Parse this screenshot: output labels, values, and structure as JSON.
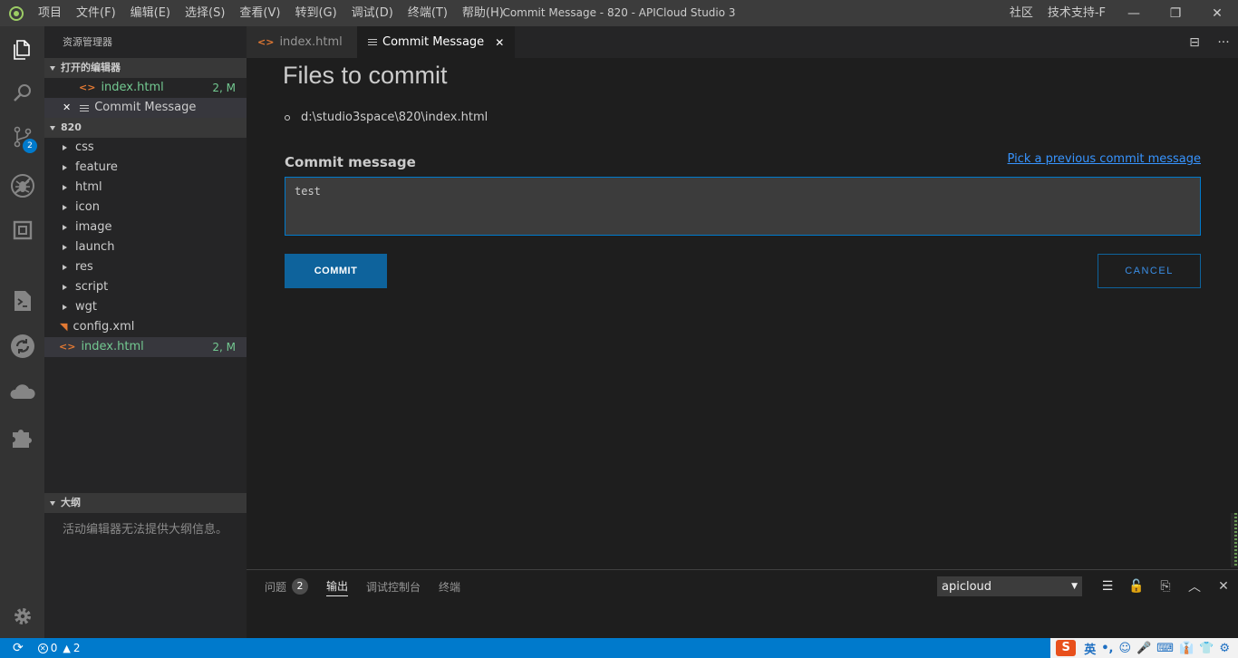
{
  "titlebar": {
    "menu": [
      "项目",
      "文件(F)",
      "编辑(E)",
      "选择(S)",
      "查看(V)",
      "转到(G)",
      "调试(D)",
      "终端(T)",
      "帮助(H)"
    ],
    "window_title": "Commit Message - 820 - APICloud Studio 3",
    "links": [
      "社区",
      "技术支持-F"
    ],
    "minimize": "—",
    "maximize": "❐",
    "close": "✕"
  },
  "activitybar": {
    "source_control_badge": "2",
    "icons": [
      "explorer-icon",
      "search-icon",
      "source-control-icon",
      "debug-icon",
      "extensions-panel-icon",
      "terminal-icon",
      "sync-icon",
      "cloud-icon",
      "puzzle-icon",
      "gear-icon"
    ]
  },
  "sidebar": {
    "title": "资源管理器",
    "open_editors_header": "打开的编辑器",
    "open_editors": [
      {
        "name": "index.html",
        "status": "2, M"
      },
      {
        "name": "Commit Message",
        "close": "✕"
      }
    ],
    "project_header": "820",
    "folders": [
      "css",
      "feature",
      "html",
      "icon",
      "image",
      "launch",
      "res",
      "script",
      "wgt"
    ],
    "files": [
      {
        "name": "config.xml",
        "status": ""
      },
      {
        "name": "index.html",
        "status": "2, M"
      }
    ],
    "outline_header": "大纲",
    "outline_empty": "活动编辑器无法提供大纲信息。"
  },
  "tabs": [
    {
      "label": "index.html",
      "active": false
    },
    {
      "label": "Commit Message",
      "active": true,
      "close": "✕"
    }
  ],
  "tab_actions": [
    "⊟",
    "···"
  ],
  "editor": {
    "files_heading": "Files to commit",
    "file_path": "d:\\studio3space\\820\\index.html",
    "commit_label": "Commit message",
    "prev_link": "Pick a previous commit message",
    "commit_value": "test",
    "commit_button": "COMMIT",
    "cancel_button": "CANCEL"
  },
  "panel": {
    "tabs": [
      {
        "label": "问题",
        "count": "2"
      },
      {
        "label": "输出",
        "active": true
      },
      {
        "label": "调试控制台"
      },
      {
        "label": "终端"
      }
    ],
    "selected_channel": "apicloud",
    "select_arrow": "▼",
    "icons": [
      "☰",
      "🔓",
      "⎘",
      "︿",
      "✕"
    ]
  },
  "statusbar": {
    "sync": "⟳",
    "errors": "0",
    "warnings": "2",
    "ime_logo": "S",
    "ime_lang": "英",
    "ime_items": [
      "•,",
      "☺",
      "🎤",
      "⌨",
      "👔",
      "👕",
      "⚙"
    ]
  },
  "colors": {
    "accent": "#007acc",
    "button": "#0e639c",
    "modified": "#73c991",
    "html_icon": "#e37933"
  }
}
